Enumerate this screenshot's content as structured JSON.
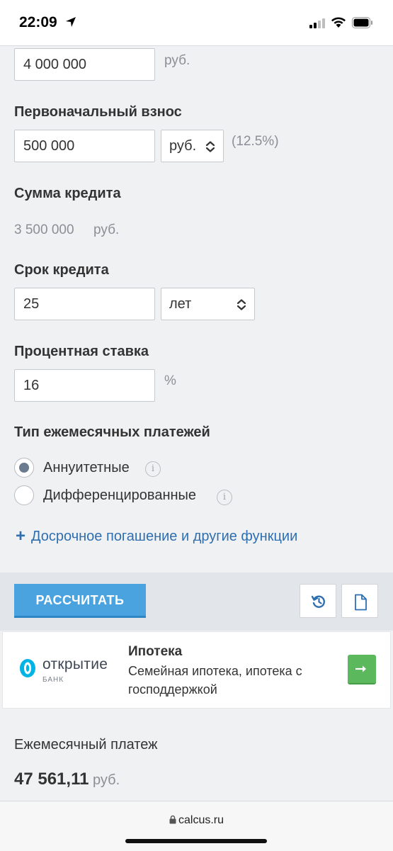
{
  "status_bar": {
    "time": "22:09"
  },
  "form": {
    "price": {
      "value": "4 000 000",
      "unit": "руб."
    },
    "down_payment": {
      "label": "Первоначальный взнос",
      "value": "500 000",
      "unit_selected": "руб.",
      "percent": "(12.5%)"
    },
    "loan_amount": {
      "label": "Сумма кредита",
      "value": "3 500 000",
      "unit": "руб."
    },
    "term": {
      "label": "Срок кредита",
      "value": "25",
      "unit_selected": "лет"
    },
    "rate": {
      "label": "Процентная ставка",
      "value": "16",
      "unit": "%"
    },
    "payment_type": {
      "label": "Тип ежемесячных платежей",
      "options": [
        {
          "label": "Аннуитетные",
          "checked": true
        },
        {
          "label": "Дифференцированные",
          "checked": false
        }
      ]
    },
    "more_link": "Досрочное погашение и другие функции"
  },
  "actions": {
    "calculate_label": "РАССЧИТАТЬ",
    "history_icon": "history-icon",
    "document_icon": "document-icon"
  },
  "ad": {
    "bank_name": "открытие",
    "bank_sub": "БАНК",
    "title": "Ипотека",
    "description": "Семейная ипотека, ипотека с господдержкой",
    "arrow_color": "#5cb85c"
  },
  "result": {
    "label": "Ежемесячный платеж",
    "value": "47 561,11",
    "unit": "руб."
  },
  "browser": {
    "url": "calcus.ru"
  },
  "colors": {
    "accent": "#4aa3df",
    "link": "#2f6fb0",
    "background": "#f0f1f3"
  }
}
